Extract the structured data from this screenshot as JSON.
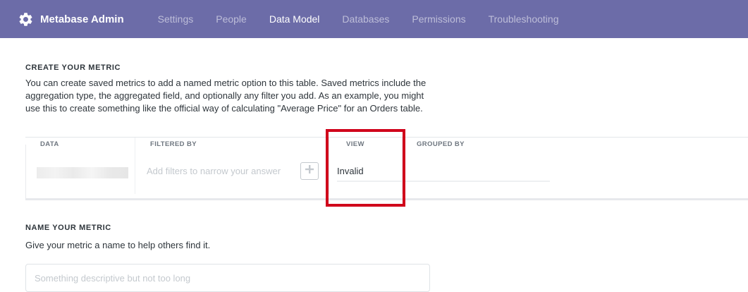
{
  "nav": {
    "brand": "Metabase Admin",
    "brand_icon": "gear-icon",
    "items": [
      {
        "label": "Settings",
        "active": false
      },
      {
        "label": "People",
        "active": false
      },
      {
        "label": "Data Model",
        "active": true
      },
      {
        "label": "Databases",
        "active": false
      },
      {
        "label": "Permissions",
        "active": false
      },
      {
        "label": "Troubleshooting",
        "active": false
      }
    ],
    "bg_color": "#6c6ca8"
  },
  "create_metric": {
    "title": "CREATE YOUR METRIC",
    "description": "You can create saved metrics to add a named metric option to this table. Saved metrics include the aggregation type, the aggregated field, and optionally any filter you add. As an example, you might use this to create something like the official way of calculating \"Average Price\" for an Orders table."
  },
  "builder": {
    "data_label": "DATA",
    "filtered_by_label": "FILTERED BY",
    "filter_placeholder": "Add filters to narrow your answer",
    "view_label": "VIEW",
    "view_value": "Invalid",
    "grouped_by_label": "GROUPED BY",
    "highlight_color": "#d0021b"
  },
  "name_metric": {
    "title": "NAME YOUR METRIC",
    "description": "Give your metric a name to help others find it.",
    "placeholder": "Something descriptive but not too long"
  }
}
